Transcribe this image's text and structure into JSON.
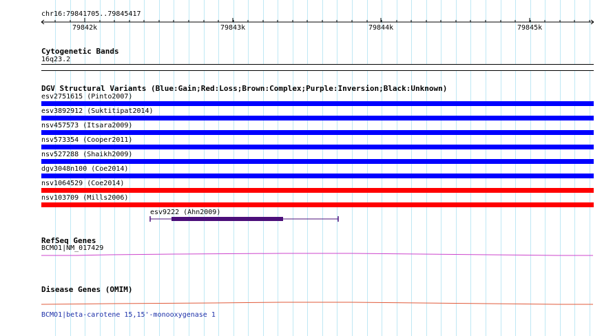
{
  "ruler": {
    "region": "chr16:79841705..79845417",
    "ticks": [
      "79842k",
      "79843k",
      "79844k",
      "79845k"
    ]
  },
  "cytoband": {
    "title": "Cytogenetic Bands",
    "band": "16q23.2"
  },
  "dgv": {
    "title": "DGV Structural Variants (Blue:Gain;Red:Loss;Brown:Complex;Purple:Inversion;Black:Unknown)",
    "variants": [
      {
        "label": "esv2751615 (Pinto2007)",
        "color": "#0000ff"
      },
      {
        "label": "esv3892912 (Suktitipat2014)",
        "color": "#0000ff"
      },
      {
        "label": "nsv457573 (Itsara2009)",
        "color": "#0000ff"
      },
      {
        "label": "nsv573354 (Cooper2011)",
        "color": "#0000ff"
      },
      {
        "label": "nsv527288 (Shaikh2009)",
        "color": "#0000ff"
      },
      {
        "label": "dgv3048n100 (Coe2014)",
        "color": "#0000ff"
      },
      {
        "label": "nsv1064529 (Coe2014)",
        "color": "#ff0000"
      },
      {
        "label": "nsv103709 (Mills2006)",
        "color": "#ff0000"
      }
    ],
    "inversion": {
      "label": "esv9222 (Ahn2009)",
      "color": "#4b0f7a"
    }
  },
  "refseq": {
    "title": "RefSeq Genes",
    "gene": "BCMO1|NM_017429",
    "color": "#cc44cc"
  },
  "omim": {
    "title": "Disease Genes (OMIM)",
    "gene": "BCMO1|beta-carotene 15,15'-monooxygenase 1",
    "color": "#e05a3a"
  }
}
